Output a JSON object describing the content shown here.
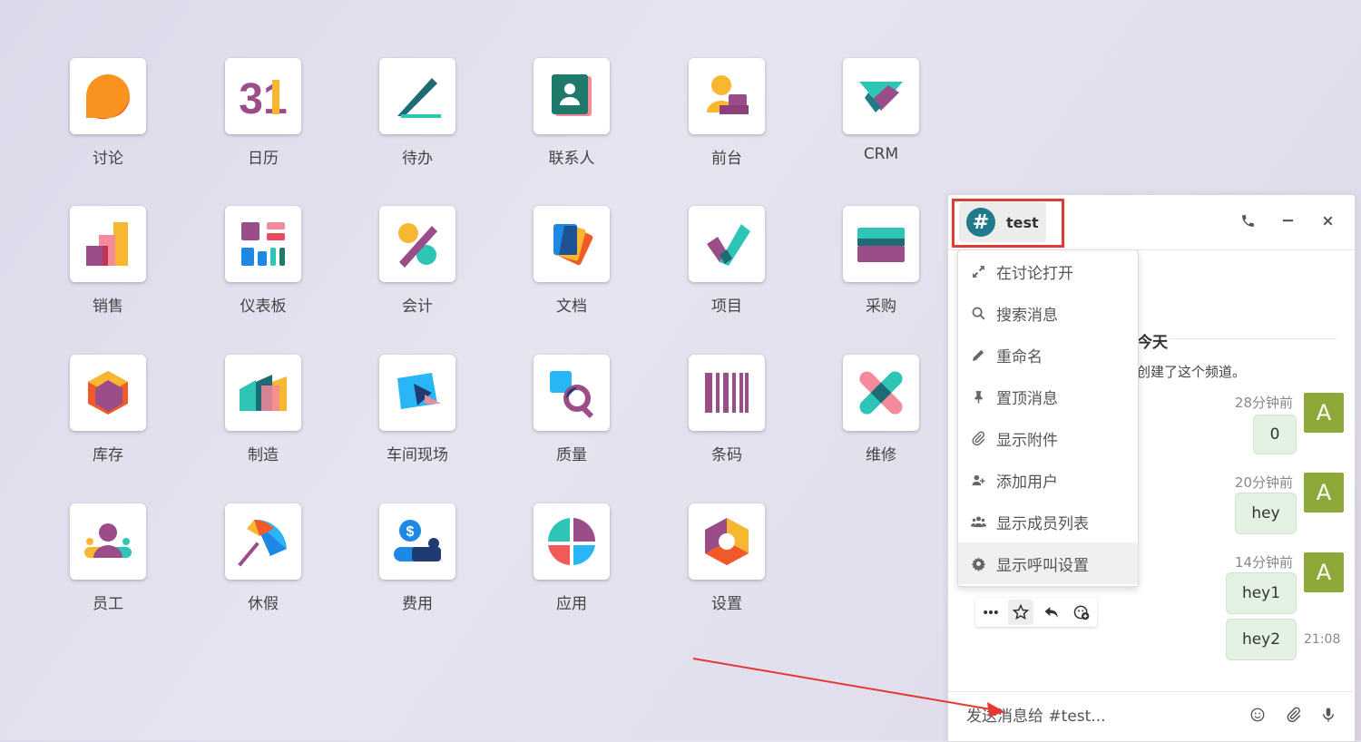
{
  "apps": [
    {
      "label": "讨论"
    },
    {
      "label": "日历"
    },
    {
      "label": "待办"
    },
    {
      "label": "联系人"
    },
    {
      "label": "前台"
    },
    {
      "label": "CRM"
    },
    {
      "label": "销售"
    },
    {
      "label": "仪表板"
    },
    {
      "label": "会计"
    },
    {
      "label": "文档"
    },
    {
      "label": "项目"
    },
    {
      "label": "采购"
    },
    {
      "label": "库存"
    },
    {
      "label": "制造"
    },
    {
      "label": "车间现场"
    },
    {
      "label": "质量"
    },
    {
      "label": "条码"
    },
    {
      "label": "维修"
    },
    {
      "label": "员工"
    },
    {
      "label": "休假"
    },
    {
      "label": "费用"
    },
    {
      "label": "应用"
    },
    {
      "label": "设置"
    }
  ],
  "calendar_day": "31",
  "expense_symbol": "$",
  "chat": {
    "channel_avatar": "#",
    "channel_name": "test",
    "menu": [
      {
        "label": "在讨论打开",
        "icon": "expand-icon"
      },
      {
        "label": "搜索消息",
        "icon": "search-icon"
      },
      {
        "label": "重命名",
        "icon": "pencil-icon"
      },
      {
        "label": "置顶消息",
        "icon": "pin-icon"
      },
      {
        "label": "显示附件",
        "icon": "paperclip-icon"
      },
      {
        "label": "添加用户",
        "icon": "add-user-icon"
      },
      {
        "label": "显示成员列表",
        "icon": "users-icon"
      },
      {
        "label": "显示呼叫设置",
        "icon": "gear-icon"
      }
    ],
    "today_label": "今天",
    "created_text": "创建了这个频道。",
    "messages": [
      {
        "time": "28分钟前",
        "text": "0",
        "avatar": "A"
      },
      {
        "time": "20分钟前",
        "text": "hey",
        "avatar": "A"
      },
      {
        "time": "14分钟前",
        "text": "hey1",
        "avatar": "A"
      },
      {
        "time": "21:08",
        "text": "hey2"
      }
    ],
    "composer_placeholder": "发送消息给 #test..."
  },
  "colors": {
    "accent_red": "#e53935",
    "channel_teal": "#1f7a8c",
    "user_avatar": "#8fa83a",
    "bubble": "#e4f2e4"
  }
}
